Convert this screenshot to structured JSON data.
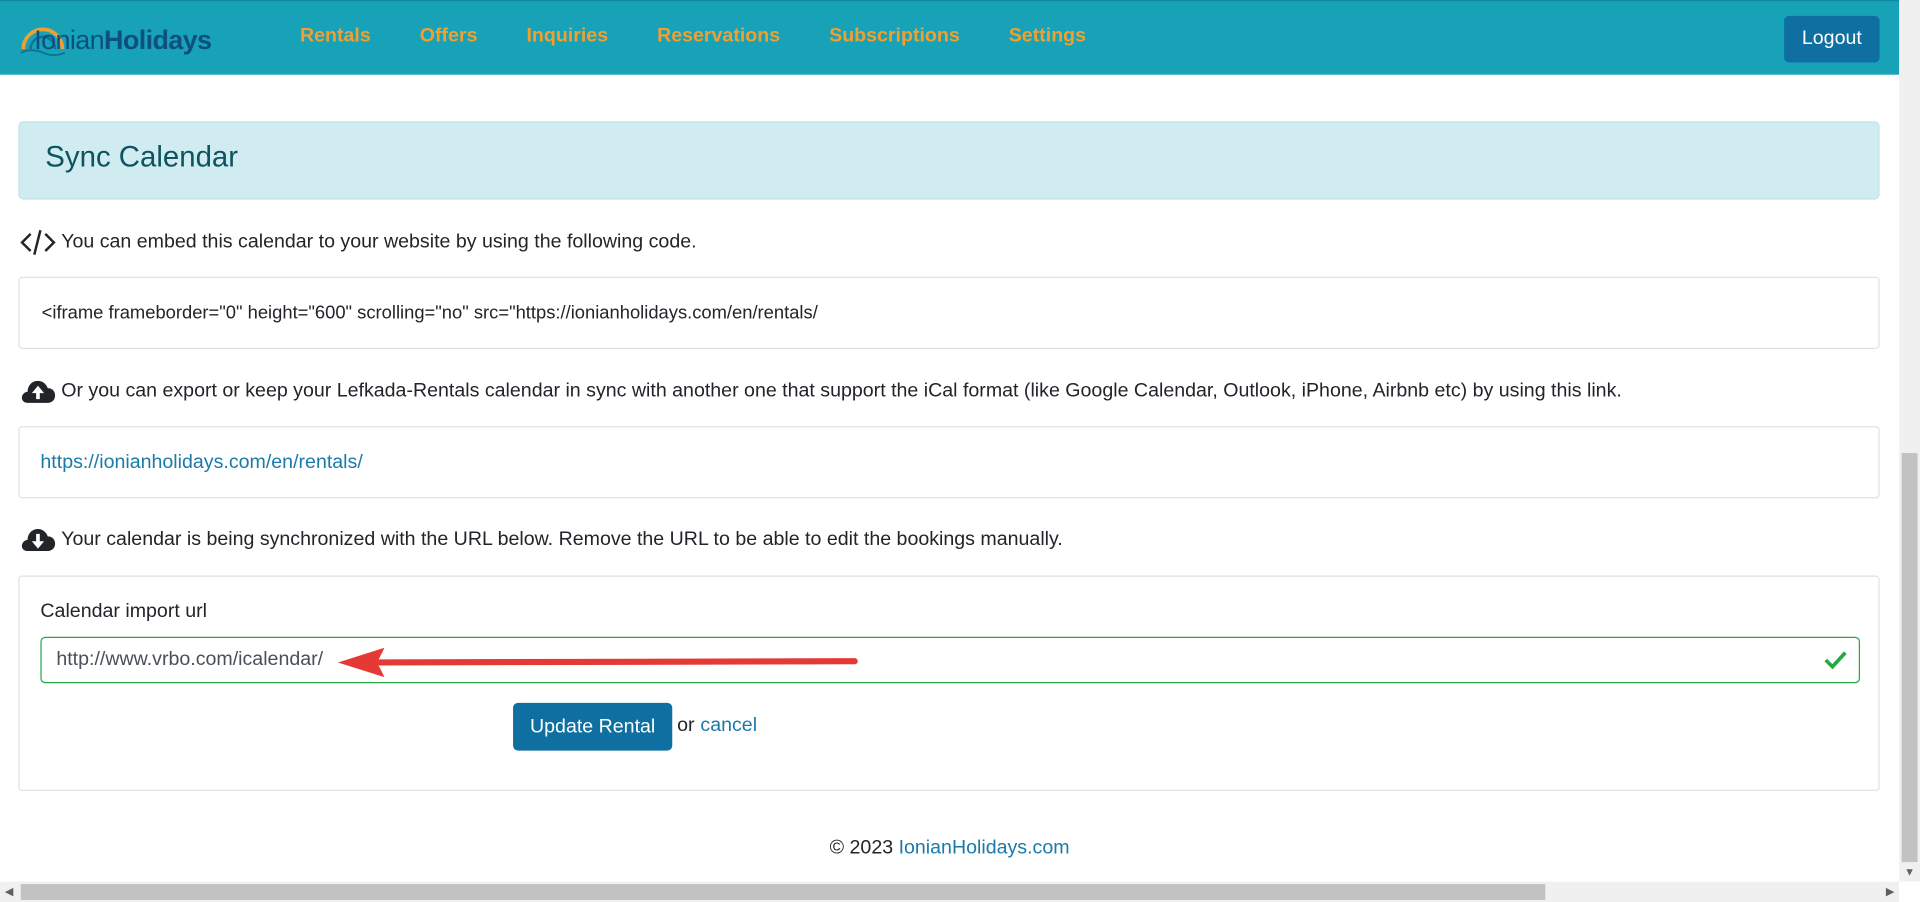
{
  "navbar": {
    "brand_part1": "Ionian",
    "brand_part2": "Holidays",
    "links": [
      "Rentals",
      "Offers",
      "Inquiries",
      "Reservations",
      "Subscriptions",
      "Settings"
    ],
    "logout_label": "Logout",
    "bg_color": "#17a2b8",
    "link_color": "#f0a030"
  },
  "header": {
    "title": "Sync Calendar"
  },
  "embed": {
    "icon": "code-icon",
    "text": "You can embed this calendar to your website by using the following code.",
    "code": "<iframe frameborder=\"0\" height=\"600\" scrolling=\"no\" src=\"https://ionianholidays.com/en/rentals/"
  },
  "export": {
    "icon": "cloud-upload-icon",
    "text": "Or you can export or keep your Lefkada-Rentals calendar in sync with another one that support the iCal format (like Google Calendar, Outlook, iPhone, Airbnb etc) by using this link.",
    "link": "https://ionianholidays.com/en/rentals/"
  },
  "import": {
    "icon": "cloud-download-icon",
    "text": "Your calendar is being synchronized with the URL below. Remove the URL to be able to edit the bookings manually.",
    "label": "Calendar import url",
    "value": "http://www.vrbo.com/icalendar/",
    "update_label": "Update Rental",
    "or_text": "or",
    "cancel_label": "cancel",
    "valid_color": "#28a745"
  },
  "footer": {
    "copyright": "© 2023",
    "link": "IonianHolidays.com"
  }
}
